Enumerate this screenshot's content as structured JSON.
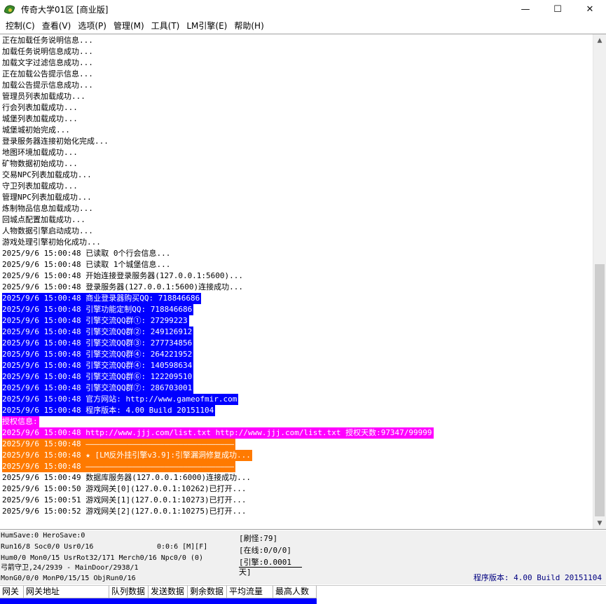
{
  "window": {
    "title": "传奇大学01区 [商业版]",
    "minimize": "—",
    "maximize": "☐",
    "close": "✕"
  },
  "menu": [
    "控制(C)",
    "查看(V)",
    "选项(P)",
    "管理(M)",
    "工具(T)",
    "LM引擎(E)",
    "帮助(H)"
  ],
  "log": [
    {
      "text": "正在加载任务说明信息...",
      "style": "normal"
    },
    {
      "text": "加载任务说明信息成功...",
      "style": "normal"
    },
    {
      "text": "加载文字过滤信息成功...",
      "style": "normal"
    },
    {
      "text": "正在加载公告提示信息...",
      "style": "normal"
    },
    {
      "text": "加载公告提示信息成功...",
      "style": "normal"
    },
    {
      "text": "管理员列表加载成功...",
      "style": "normal"
    },
    {
      "text": "行会列表加载成功...",
      "style": "normal"
    },
    {
      "text": "城堡列表加载成功...",
      "style": "normal"
    },
    {
      "text": "城堡城初始完成...",
      "style": "normal"
    },
    {
      "text": "登录服务器连接初始化完成...",
      "style": "normal"
    },
    {
      "text": "地图环境加载成功...",
      "style": "normal"
    },
    {
      "text": "矿物数据初始成功...",
      "style": "normal"
    },
    {
      "text": "交易NPC列表加载成功...",
      "style": "normal"
    },
    {
      "text": "守卫列表加载成功...",
      "style": "normal"
    },
    {
      "text": "管理NPC列表加载成功...",
      "style": "normal"
    },
    {
      "text": "炼制物品信息加载成功...",
      "style": "normal"
    },
    {
      "text": "回城点配置加载成功...",
      "style": "normal"
    },
    {
      "text": "人物数据引擎启动成功...",
      "style": "normal"
    },
    {
      "text": "游戏处理引擎初始化成功...",
      "style": "normal"
    },
    {
      "text": "2025/9/6 15:00:48 已读取 0个行会信息...",
      "style": "normal"
    },
    {
      "text": "2025/9/6 15:00:48 已读取 1个城堡信息...",
      "style": "normal"
    },
    {
      "text": "2025/9/6 15:00:48 开始连接登录服务器(127.0.0.1:5600)...",
      "style": "normal"
    },
    {
      "text": "2025/9/6 15:00:48 登录服务器(127.0.0.1:5600)连接成功...",
      "style": "normal"
    },
    {
      "text": "2025/9/6 15:00:48 商业登录器购买QQ: 718846686",
      "style": "blue"
    },
    {
      "text": "2025/9/6 15:00:48 引擎功能定制QQ: 718846686",
      "style": "blue"
    },
    {
      "text": "2025/9/6 15:00:48 引擎交流QQ群①: 27299223",
      "style": "blue"
    },
    {
      "text": "2025/9/6 15:00:48 引擎交流QQ群②: 249126912",
      "style": "blue"
    },
    {
      "text": "2025/9/6 15:00:48 引擎交流QQ群③: 277734856",
      "style": "blue"
    },
    {
      "text": "2025/9/6 15:00:48 引擎交流QQ群④: 264221952",
      "style": "blue"
    },
    {
      "text": "2025/9/6 15:00:48 引擎交流QQ群④: 140598634",
      "style": "blue"
    },
    {
      "text": "2025/9/6 15:00:48 引擎交流QQ群⑥: 122209510",
      "style": "blue"
    },
    {
      "text": "2025/9/6 15:00:48 引擎交流QQ群⑦: 286703001",
      "style": "blue"
    },
    {
      "text": "2025/9/6 15:00:48 官方网站: http://www.gameofmir.com",
      "style": "blue"
    },
    {
      "text": "2025/9/6 15:00:48 程序版本: 4.00 Build 20151104",
      "style": "blue"
    },
    {
      "text": "授权信息:",
      "style": "magenta"
    },
    {
      "text": "2025/9/6 15:00:48 http://www.jjj.com/list.txt http://www.jjj.com/list.txt 授权天数:97347/99999",
      "style": "magenta"
    },
    {
      "text": "2025/9/6 15:00:48 ————————————————————————————————",
      "style": "orange"
    },
    {
      "text": "2025/9/6 15:00:48 ★ [LM反外挂引擎v3.9]:引擎漏洞修复成功...",
      "style": "orange"
    },
    {
      "text": "2025/9/6 15:00:48 ————————————————————————————————",
      "style": "orange"
    },
    {
      "text": "2025/9/6 15:00:49 数据库服务器(127.0.0.1:6000)连接成功...",
      "style": "normal"
    },
    {
      "text": "2025/9/6 15:00:50 游戏网关[0](127.0.0.1:10262)已打开...",
      "style": "normal"
    },
    {
      "text": "2025/9/6 15:00:51 游戏网关[1](127.0.0.1:10273)已打开...",
      "style": "normal"
    },
    {
      "text": "2025/9/6 15:00:52 游戏网关[2](127.0.0.1:10275)已打开...",
      "style": "normal"
    }
  ],
  "status": {
    "line1": "HumSave:0 HeroSave:0",
    "line2": "Run16/8 Soc0/0 Usr0/16",
    "timer": "0:0:6 [M][F]",
    "line3": "Hum0/0 Mon0/15 UsrRot32/171 Merch0/16 Npc0/0 (0)",
    "line4": "弓箭守卫,24/2939 - MainDoor/2938/1",
    "line5": "MonG0/0/0 MonP0/15/15 ObjRun0/16",
    "refresh": "[刷怪:79]",
    "online": "[在线:0/0/0]",
    "engine": "[引擎:0.0001天]",
    "version": "程序版本: 4.00 Build 20151104"
  },
  "gates": {
    "columns": [
      "网关",
      "网关地址",
      "队列数据",
      "发送数据",
      "剩余数据",
      "平均流量",
      "最高人数"
    ]
  }
}
